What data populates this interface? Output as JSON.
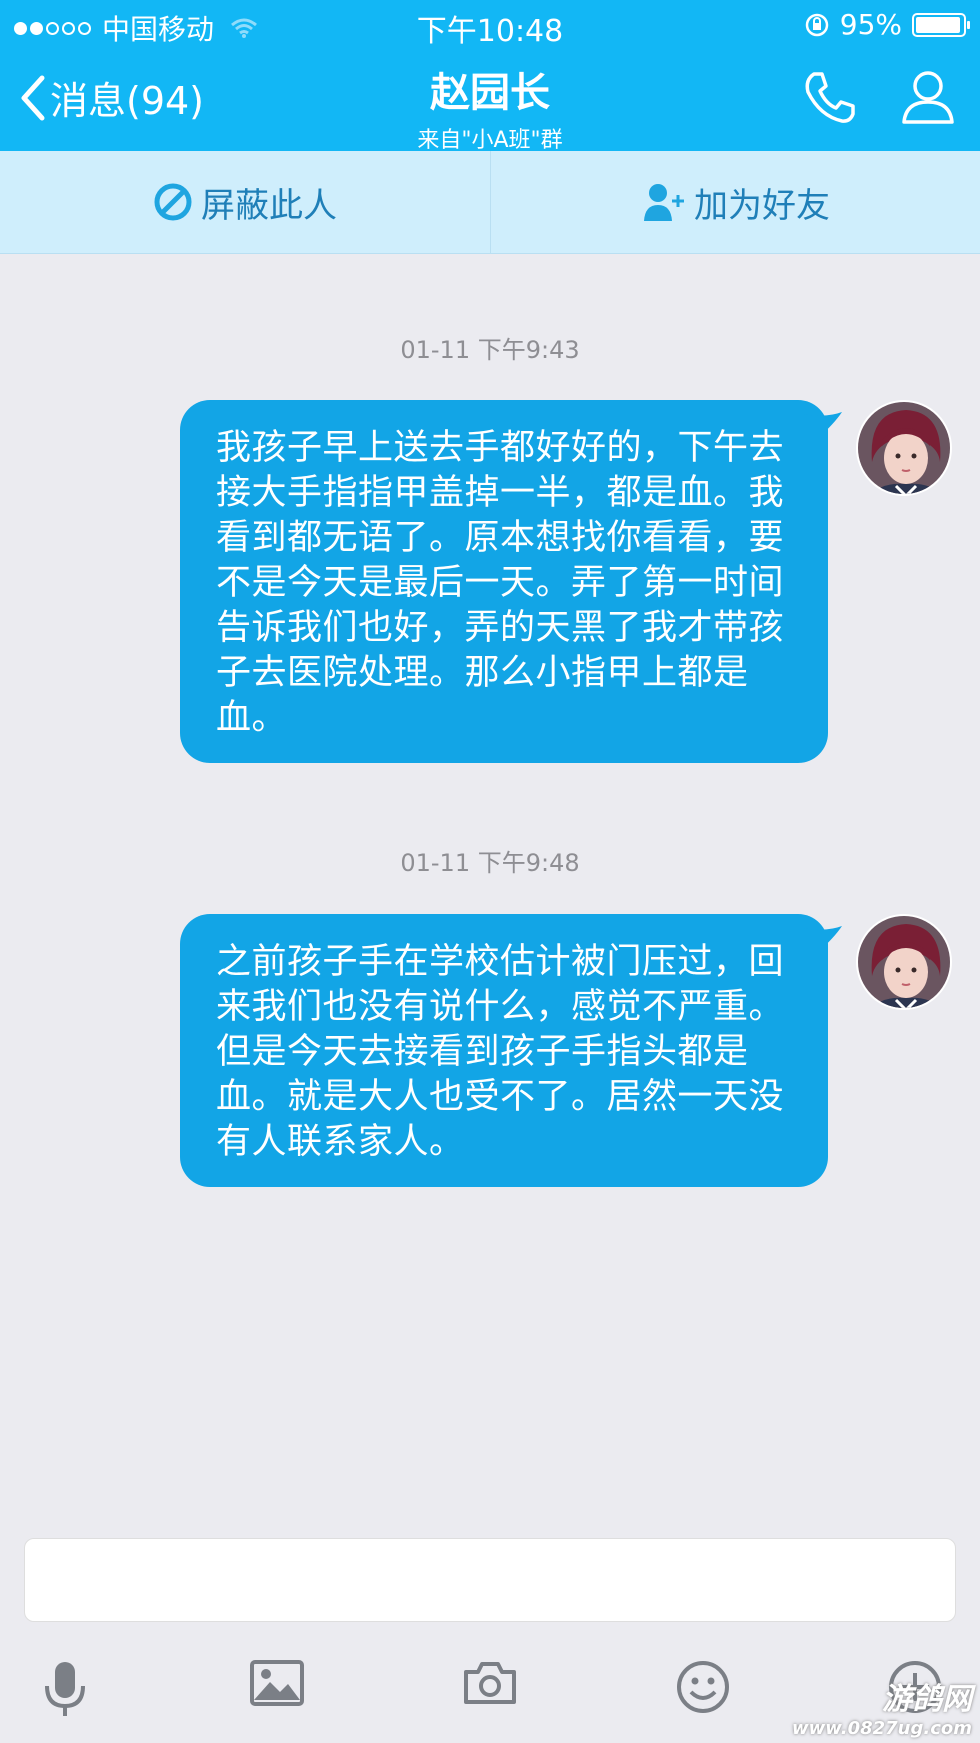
{
  "status_bar": {
    "carrier": "中国移动",
    "time": "下午10:48",
    "battery_percent": "95%",
    "battery_level": 0.95,
    "signal_strength": 2
  },
  "nav": {
    "back_label": "消息(94)",
    "title": "赵园长",
    "subtitle": "来自\"小A班\"群",
    "icons": [
      "phone-icon",
      "contact-icon"
    ]
  },
  "actions": {
    "block_label": "屏蔽此人",
    "add_friend_label": "加为好友"
  },
  "messages": [
    {
      "timestamp": "01-11 下午9:43",
      "text": "我孩子早上送去手都好好的，下午去接大手指指甲盖掉一半，都是血。我看到都无语了。原本想找你看看，要不是今天是最后一天。弄了第一时间告诉我们也好，弄的天黑了我才带孩子去医院处理。那么小指甲上都是血。"
    },
    {
      "timestamp": "01-11 下午9:48",
      "text": "之前孩子手在学校估计被门压过，回来我们也没有说什么，感觉不严重。但是今天去接看到孩子手指头都是血。就是大人也受不了。居然一天没有人联系家人。"
    }
  ],
  "input": {
    "placeholder": "",
    "tools": [
      "microphone-icon",
      "image-icon",
      "camera-icon",
      "emoji-icon",
      "plus-icon"
    ]
  },
  "watermark": {
    "line1": "游鸽网",
    "line2": "www.0827ug.com"
  },
  "colors": {
    "header": "#12b7f5",
    "bubble": "#12a5e6",
    "action_bar": "#cfeefc",
    "background": "#ebebf0"
  }
}
